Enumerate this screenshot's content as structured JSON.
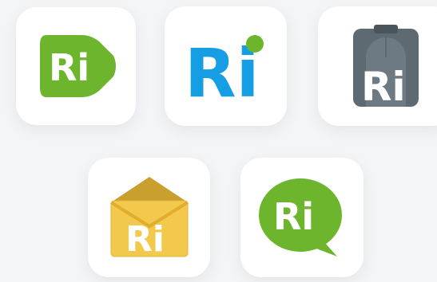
{
  "colors": {
    "background": "#f4f5f7",
    "tile": "#ffffff",
    "green": "#6cb52d",
    "blue": "#169ee5",
    "slate": "#5e6a72",
    "yellow": "#f2c94c",
    "yellow_dark": "#e0ad2e",
    "white": "#ffffff"
  },
  "app_icons": [
    {
      "name": "ri-play-logo",
      "text": "Ri"
    },
    {
      "name": "ri-wordmark-logo",
      "text": "Ri"
    },
    {
      "name": "ri-clipboard-logo",
      "text": "Ri"
    },
    {
      "name": "ri-envelope-logo",
      "text": "Ri"
    },
    {
      "name": "ri-speech-bubble-logo",
      "text": "Ri"
    }
  ]
}
